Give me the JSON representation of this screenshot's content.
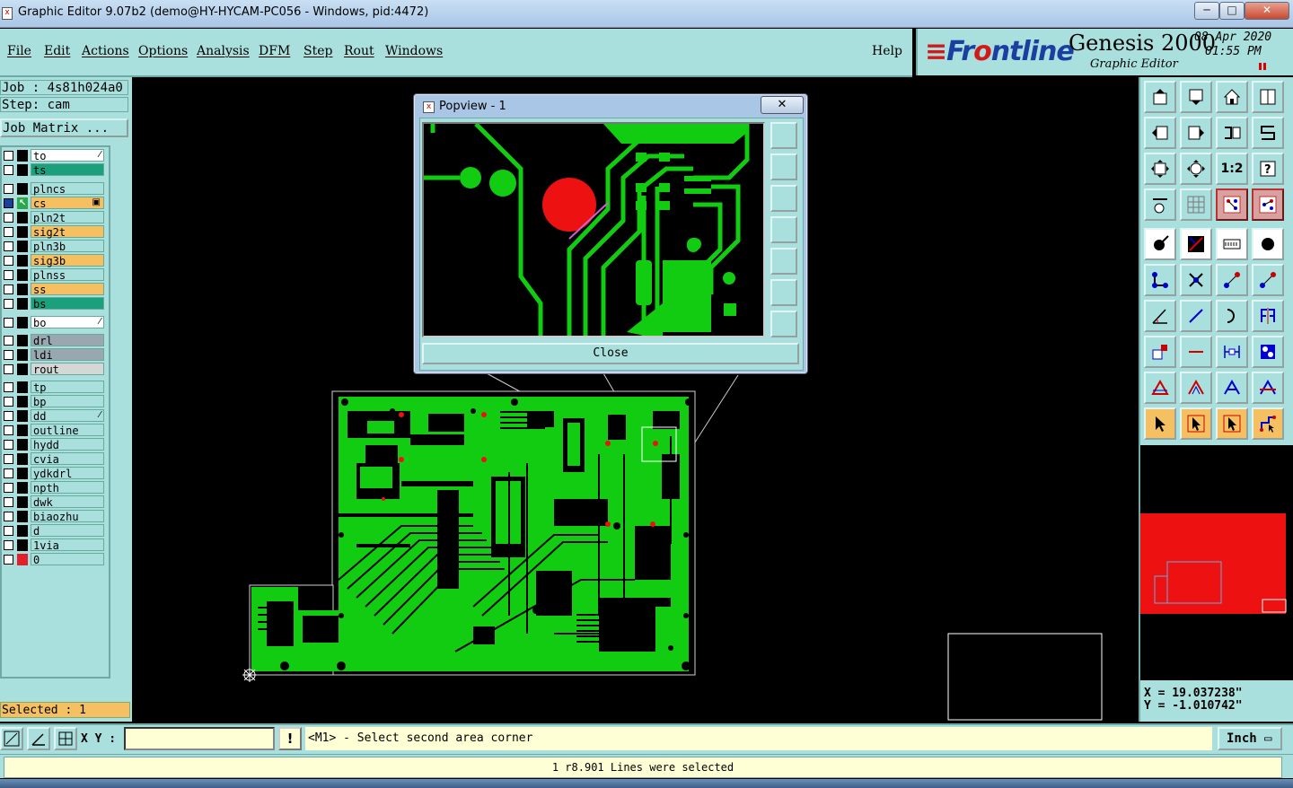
{
  "window": {
    "title": "Graphic Editor 9.07b2 (demo@HY-HYCAM-PC056 - Windows, pid:4472)",
    "min_label": "─",
    "max_label": "□",
    "close_label": "✕"
  },
  "menu": {
    "items": [
      "File",
      "Edit",
      "Actions",
      "Options",
      "Analysis",
      "DFM",
      "Step",
      "Rout",
      "Windows"
    ],
    "help": "Help"
  },
  "header": {
    "brand_pre": "Fr",
    "brand_o": "o",
    "brand_post": "ntline",
    "product": "Genesis 2000",
    "subtitle": "Graphic Editor",
    "date": "08 Apr 2020",
    "time": "01:55 PM"
  },
  "left": {
    "job_line": "Job : 4s81h024a0",
    "step_line": "Step: cam",
    "job_matrix": "Job Matrix ...",
    "selected": "Selected : 1",
    "layers": [
      {
        "name": "to",
        "color": "#ffffff",
        "mark": "⁄"
      },
      {
        "name": "ts",
        "color": "#1aa07a",
        "mark": ""
      },
      {
        "name": "plncs",
        "color": "#a9dfdd",
        "mark": ""
      },
      {
        "name": "cs",
        "color": "#f5c061",
        "mark": "▣",
        "active": true
      },
      {
        "name": "pln2t",
        "color": "#a9dfdd",
        "mark": ""
      },
      {
        "name": "sig2t",
        "color": "#f5c061",
        "mark": ""
      },
      {
        "name": "pln3b",
        "color": "#a9dfdd",
        "mark": ""
      },
      {
        "name": "sig3b",
        "color": "#f5c061",
        "mark": ""
      },
      {
        "name": "plnss",
        "color": "#a9dfdd",
        "mark": ""
      },
      {
        "name": "ss",
        "color": "#f5c061",
        "mark": ""
      },
      {
        "name": "bs",
        "color": "#1aa07a",
        "mark": ""
      },
      {
        "name": "bo",
        "color": "#ffffff",
        "mark": "⁄"
      },
      {
        "name": "drl",
        "color": "#9aa7b0",
        "mark": ""
      },
      {
        "name": "ldi",
        "color": "#9aa7b0",
        "mark": ""
      },
      {
        "name": "rout",
        "color": "#d6d6d6",
        "mark": ""
      },
      {
        "name": "tp",
        "color": "#a9dfdd",
        "mark": ""
      },
      {
        "name": "bp",
        "color": "#a9dfdd",
        "mark": ""
      },
      {
        "name": "dd",
        "color": "#a9dfdd",
        "mark": "⁄"
      },
      {
        "name": "outline",
        "color": "#a9dfdd",
        "mark": ""
      },
      {
        "name": "hydd",
        "color": "#a9dfdd",
        "mark": ""
      },
      {
        "name": "cvia",
        "color": "#a9dfdd",
        "mark": ""
      },
      {
        "name": "ydkdrl",
        "color": "#a9dfdd",
        "mark": ""
      },
      {
        "name": "npth",
        "color": "#a9dfdd",
        "mark": ""
      },
      {
        "name": "dwk",
        "color": "#a9dfdd",
        "mark": ""
      },
      {
        "name": "biaozhu",
        "color": "#a9dfdd",
        "mark": ""
      },
      {
        "name": "d",
        "color": "#a9dfdd",
        "mark": ""
      },
      {
        "name": "1via",
        "color": "#a9dfdd",
        "mark": ""
      },
      {
        "name": "0",
        "color": "#a9dfdd",
        "mark": "",
        "icon_color": "#e0202a"
      }
    ]
  },
  "popview": {
    "title": "Popview - 1",
    "close_x": "✕",
    "close_button": "Close"
  },
  "toolbox": {
    "one_to_two": "1:2",
    "help_q": "?"
  },
  "coords": {
    "x": "X = 19.037238\"",
    "y": "Y = -1.010742\""
  },
  "bottom": {
    "xy_label": "X Y :",
    "xy_value": "",
    "bang": "!",
    "prompt": "<M1> - Select second area corner",
    "units": "Inch",
    "status": "1 r8.901 Lines were selected"
  },
  "colors": {
    "panel": "#a9dfdd",
    "board": "#11cc11",
    "pad_red": "#ee1111",
    "highlight_orange": "#f5c061"
  }
}
